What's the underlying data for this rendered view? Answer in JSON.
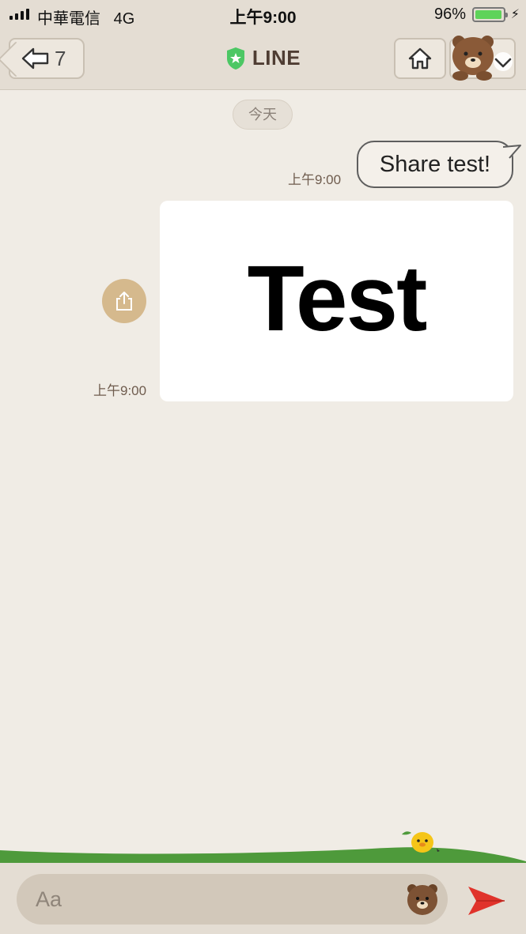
{
  "status_bar": {
    "carrier": "中華電信",
    "network": "4G",
    "time": "上午9:00",
    "battery": "96%",
    "battery_level": 0.96
  },
  "header": {
    "back_count": "7",
    "title": "LINE"
  },
  "chat": {
    "date_label": "今天",
    "messages": [
      {
        "type": "text",
        "text": "Share test!",
        "time": "上午9:00"
      },
      {
        "type": "image",
        "image_text": "Test",
        "time": "上午9:00"
      }
    ]
  },
  "input": {
    "placeholder": "Aa"
  },
  "colors": {
    "background": "#f0ece5",
    "header": "#e4ddd3",
    "line_green": "#4cc764",
    "send_red": "#e0332b",
    "share_tan": "#d5b98d"
  }
}
